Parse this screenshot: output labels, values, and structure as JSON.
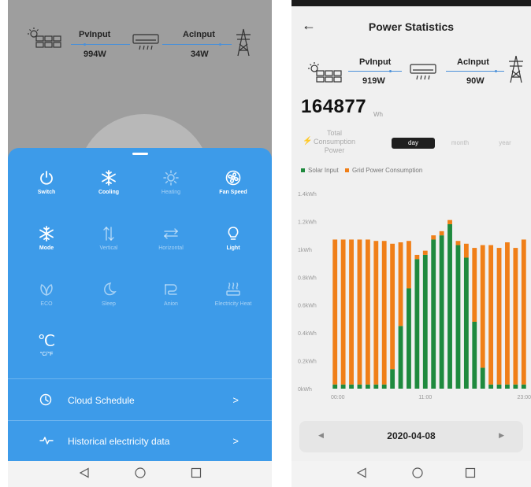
{
  "left_screen": {
    "flow": {
      "pv_label": "PvInput",
      "pv_value": "994W",
      "ac_label": "AcInput",
      "ac_value": "34W"
    },
    "controls": [
      {
        "label": "Switch",
        "icon": "power-icon",
        "active": true
      },
      {
        "label": "Cooling",
        "icon": "snowflake-icon",
        "active": true
      },
      {
        "label": "Heating",
        "icon": "sun-icon",
        "active": false
      },
      {
        "label": "Fan Speed",
        "icon": "fan-icon",
        "active": true
      },
      {
        "label": "Mode",
        "icon": "snowflake-icon",
        "active": true
      },
      {
        "label": "Vertical",
        "icon": "vertical-swing-icon",
        "active": false
      },
      {
        "label": "Horizontal",
        "icon": "horizontal-swing-icon",
        "active": false
      },
      {
        "label": "Light",
        "icon": "bulb-icon",
        "active": true
      },
      {
        "label": "ECO",
        "icon": "leaf-icon",
        "active": false
      },
      {
        "label": "Sleep",
        "icon": "moon-icon",
        "active": false
      },
      {
        "label": "Anion",
        "icon": "anion-icon",
        "active": false
      },
      {
        "label": "Electricity Heat",
        "icon": "heat-icon",
        "active": false
      },
      {
        "label": "°C/°F",
        "icon": "celsius-icon",
        "glyph": "℃",
        "active": true
      }
    ],
    "rows": [
      {
        "label": "Cloud Schedule",
        "icon": "clock-icon",
        "chevron": ">"
      },
      {
        "label": "Historical electricity data",
        "icon": "pulse-icon",
        "chevron": ">"
      }
    ]
  },
  "right_screen": {
    "back_glyph": "←",
    "title": "Power Statistics",
    "flow": {
      "pv_label": "PvInput",
      "pv_value": "919W",
      "ac_label": "AcInput",
      "ac_value": "90W"
    },
    "total_value": "164877",
    "total_unit": "Wh",
    "total_label_lines": [
      "Total",
      "Consumption",
      "Power"
    ],
    "period_tabs": [
      {
        "label": "day",
        "active": true
      },
      {
        "label": "month",
        "active": false
      },
      {
        "label": "year",
        "active": false
      }
    ],
    "date": "2020-04-08",
    "prev_glyph": "◀",
    "next_glyph": "▶"
  },
  "colors": {
    "panel_blue": "#3d9be9",
    "solar_green": "#1f8a3e",
    "grid_orange": "#f07f18",
    "flow_blue": "#4a90d9"
  },
  "chart_data": {
    "type": "bar",
    "stacked": true,
    "x_tick_labels": [
      "00:00",
      "11:00",
      "23:00"
    ],
    "y_tick_labels": [
      "0kWh",
      "0.2kWh",
      "0.4kWh",
      "0.6kWh",
      "0.8kWh",
      "1kWh",
      "1.2kWh",
      "1.4kWh"
    ],
    "ylim": [
      0,
      1.4
    ],
    "y_unit": "kWh",
    "legend": [
      "Solar Input",
      "Grid Power Consumption"
    ],
    "legend_placement": "top-left",
    "series": [
      {
        "name": "Solar Input",
        "color": "#1f8a3e",
        "values": [
          0.03,
          0.03,
          0.03,
          0.03,
          0.03,
          0.03,
          0.03,
          0.14,
          0.45,
          0.72,
          0.93,
          0.96,
          1.07,
          1.1,
          1.18,
          1.03,
          0.94,
          0.48,
          0.15,
          0.03,
          0.03,
          0.03,
          0.03,
          0.03
        ]
      },
      {
        "name": "Grid Power Consumption",
        "color": "#f07f18",
        "values": [
          1.04,
          1.04,
          1.04,
          1.04,
          1.04,
          1.03,
          1.03,
          0.9,
          0.6,
          0.34,
          0.03,
          0.03,
          0.03,
          0.03,
          0.03,
          0.03,
          0.1,
          0.53,
          0.88,
          1.0,
          0.98,
          1.02,
          0.98,
          1.04
        ]
      }
    ]
  }
}
